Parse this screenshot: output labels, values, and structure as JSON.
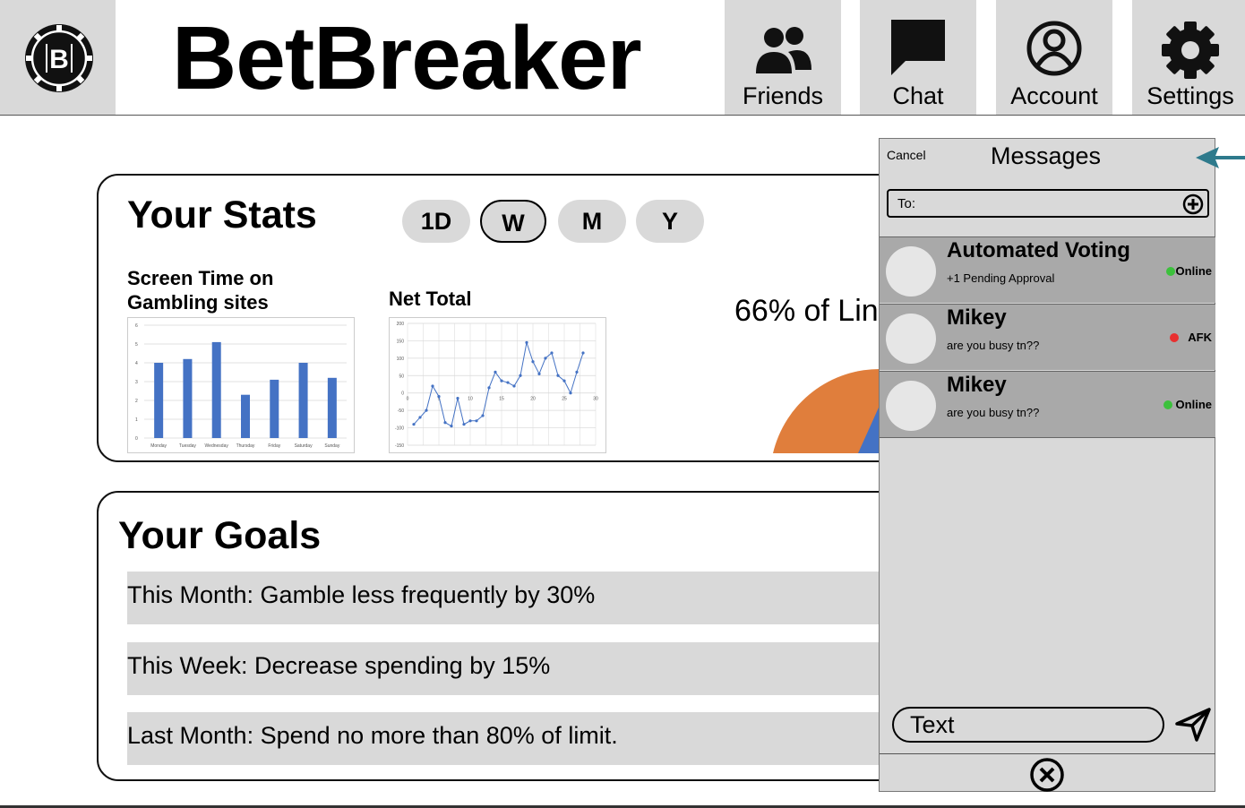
{
  "header": {
    "title": "BetBreaker",
    "nav": [
      {
        "label": "Friends",
        "icon": "people-icon"
      },
      {
        "label": "Chat",
        "icon": "chat-bubble-icon"
      },
      {
        "label": "Account",
        "icon": "account-circle-icon"
      },
      {
        "label": "Settings",
        "icon": "gear-icon"
      }
    ]
  },
  "stats": {
    "title": "Your Stats",
    "ranges": [
      "1D",
      "W",
      "M",
      "Y"
    ],
    "selected_range": "W",
    "screen_time_title": "Screen Time on Gambling sites",
    "net_total_title": "Net Total",
    "limit_text": "66% of Lin"
  },
  "goals": {
    "title": "Your Goals",
    "items": [
      "This Month: Gamble less frequently by 30%",
      "This Week: Decrease spending by 15%",
      "Last Month: Spend no more than 80% of limit."
    ]
  },
  "messages": {
    "cancel": "Cancel",
    "title": "Messages",
    "to_label": "To:",
    "conversations": [
      {
        "name": "Automated Voting",
        "preview": "+1 Pending Approval",
        "status": "Online",
        "status_color": "#3cc13c"
      },
      {
        "name": "Mikey",
        "preview": "are you busy tn??",
        "status": "AFK",
        "status_color": "#e83030"
      },
      {
        "name": "Mikey",
        "preview": "are you busy tn??",
        "status": "Online",
        "status_color": "#3cc13c"
      }
    ],
    "input_placeholder": "Text"
  },
  "colors": {
    "bar_blue": "#4472c4",
    "pie_orange": "#e07e3c",
    "panel_gray": "#d9d9d9",
    "arrow_teal": "#2e7a8c"
  },
  "chart_data": [
    {
      "type": "bar",
      "categories": [
        "Monday",
        "Tuesday",
        "Wednesday",
        "Thursday",
        "Friday",
        "Saturday",
        "Sunday"
      ],
      "values": [
        4.0,
        4.2,
        5.1,
        2.3,
        3.1,
        4.0,
        3.2
      ],
      "ylim": [
        0,
        6
      ],
      "yticks": [
        "0",
        "1",
        "2",
        "3",
        "4",
        "5",
        "6"
      ],
      "grid": true
    },
    {
      "type": "line",
      "x": [
        1,
        2,
        3,
        4,
        5,
        6,
        7,
        8,
        9,
        10,
        11,
        12,
        13,
        14,
        15,
        16,
        17,
        18,
        19,
        20,
        21,
        22,
        23,
        24,
        25,
        26,
        27,
        28
      ],
      "values": [
        -90,
        -70,
        -50,
        20,
        -10,
        -85,
        -95,
        -15,
        -90,
        -80,
        -80,
        -65,
        15,
        60,
        35,
        30,
        20,
        50,
        145,
        90,
        55,
        100,
        115,
        50,
        35,
        0,
        60,
        115
      ],
      "xlim": [
        0,
        30
      ],
      "ylim": [
        -150,
        200
      ],
      "xticks": [
        "0",
        "5",
        "10",
        "15",
        "20",
        "25",
        "30"
      ],
      "yticks": [
        "200",
        "150",
        "100",
        "50",
        "0",
        "-50",
        "-100",
        "-150"
      ],
      "grid": true
    }
  ]
}
